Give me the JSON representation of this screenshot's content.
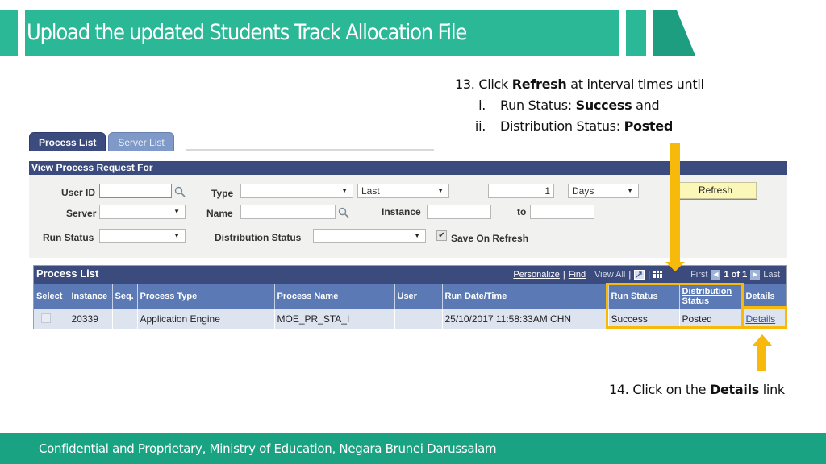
{
  "slide": {
    "title": "Upload the updated Students Track Allocation File",
    "footer": "Confidential and Proprietary, Ministry of Education, Negara Brunei Darussalam",
    "accent_color": "#2bb896",
    "highlight_color": "#f7b90a"
  },
  "instructions": {
    "step13": {
      "prefix": "13. Click ",
      "bold": "Refresh",
      "suffix": " at interval times until",
      "items": [
        {
          "numeral": "i.",
          "text": "Run Status: ",
          "bold": "Success",
          "suffix": " and"
        },
        {
          "numeral": "ii.",
          "text": "Distribution Status: ",
          "bold": "Posted",
          "suffix": ""
        }
      ]
    },
    "step14": {
      "prefix": "14. Click on the ",
      "bold": "Details",
      "suffix": " link"
    }
  },
  "tabs": [
    {
      "label": "Process List",
      "active": true
    },
    {
      "label": "Server List",
      "active": false
    }
  ],
  "filter_panel": {
    "header": "View Process Request For",
    "user_id": {
      "label": "User ID",
      "value": ""
    },
    "type": {
      "label": "Type",
      "value": ""
    },
    "last": {
      "value": "Last"
    },
    "days_count": {
      "value": "1"
    },
    "days_unit": {
      "value": "Days"
    },
    "refresh_button": "Refresh",
    "server": {
      "label": "Server",
      "value": ""
    },
    "name": {
      "label": "Name",
      "value": ""
    },
    "instance": {
      "label": "Instance",
      "value": ""
    },
    "to": {
      "label": "to",
      "value": ""
    },
    "run_status": {
      "label": "Run Status",
      "value": ""
    },
    "distribution_status": {
      "label": "Distribution Status",
      "value": ""
    },
    "save_on_refresh": {
      "label": "Save On Refresh",
      "checked": true
    }
  },
  "process_list": {
    "title": "Process List",
    "tools": {
      "personalize": "Personalize",
      "find": "Find",
      "view_all": "View All",
      "first": "First",
      "count": "1 of 1",
      "last": "Last"
    },
    "columns": [
      "Select",
      "Instance",
      "Seq.",
      "Process Type",
      "Process Name",
      "User",
      "Run Date/Time",
      "Run Status",
      "Distribution Status",
      "Details"
    ],
    "rows": [
      {
        "select": "",
        "instance": "20339",
        "seq": "",
        "process_type": "Application Engine",
        "process_name": "MOE_PR_STA_I",
        "user": "",
        "run_datetime": "25/10/2017 11:58:33AM CHN",
        "run_status": "Success",
        "distribution_status": "Posted",
        "details": "Details"
      }
    ]
  }
}
